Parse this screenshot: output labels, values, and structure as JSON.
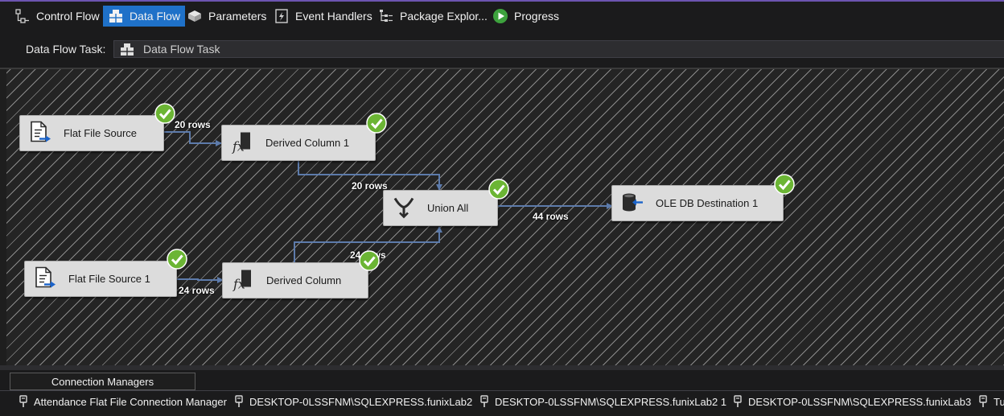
{
  "tabs": [
    {
      "label": "Control Flow",
      "icon": "control-flow-icon",
      "active": false
    },
    {
      "label": "Data Flow",
      "icon": "data-flow-icon",
      "active": true
    },
    {
      "label": "Parameters",
      "icon": "parameters-icon",
      "active": false
    },
    {
      "label": "Event Handlers",
      "icon": "event-handlers-icon",
      "active": false
    },
    {
      "label": "Package Explor...",
      "icon": "package-explorer-icon",
      "active": false
    },
    {
      "label": "Progress",
      "icon": "progress-icon",
      "active": false
    }
  ],
  "task": {
    "label": "Data Flow Task:",
    "value": "Data Flow Task"
  },
  "components": {
    "flat_file_source": "Flat File Source",
    "flat_file_source_1": "Flat File Source 1",
    "derived_column_1": "Derived Column 1",
    "derived_column": "Derived Column",
    "union_all": "Union All",
    "ole_db_destination_1": "OLE DB Destination 1"
  },
  "paths": {
    "source_to_derived1": "20 rows",
    "derived1_to_union": "20 rows",
    "source1_to_derived": "24 rows",
    "derived_to_union": "24 rows",
    "union_to_destination": "44 rows"
  },
  "connection_managers": {
    "tab_label": "Connection Managers",
    "items": [
      "Attendance Flat File Connection Manager",
      "DESKTOP-0LSSFNM\\SQLEXPRESS.funixLab2",
      "DESKTOP-0LSSFNM\\SQLEXPRESS.funixLab2 1",
      "DESKTOP-0LSSFNM\\SQLEXPRESS.funixLab3",
      "Tu"
    ]
  },
  "colors": {
    "accent": "#1f71c8",
    "path_arrow": "#5d7bab",
    "success_green": "#6bb534",
    "component_bg": "#dcdcdc"
  }
}
